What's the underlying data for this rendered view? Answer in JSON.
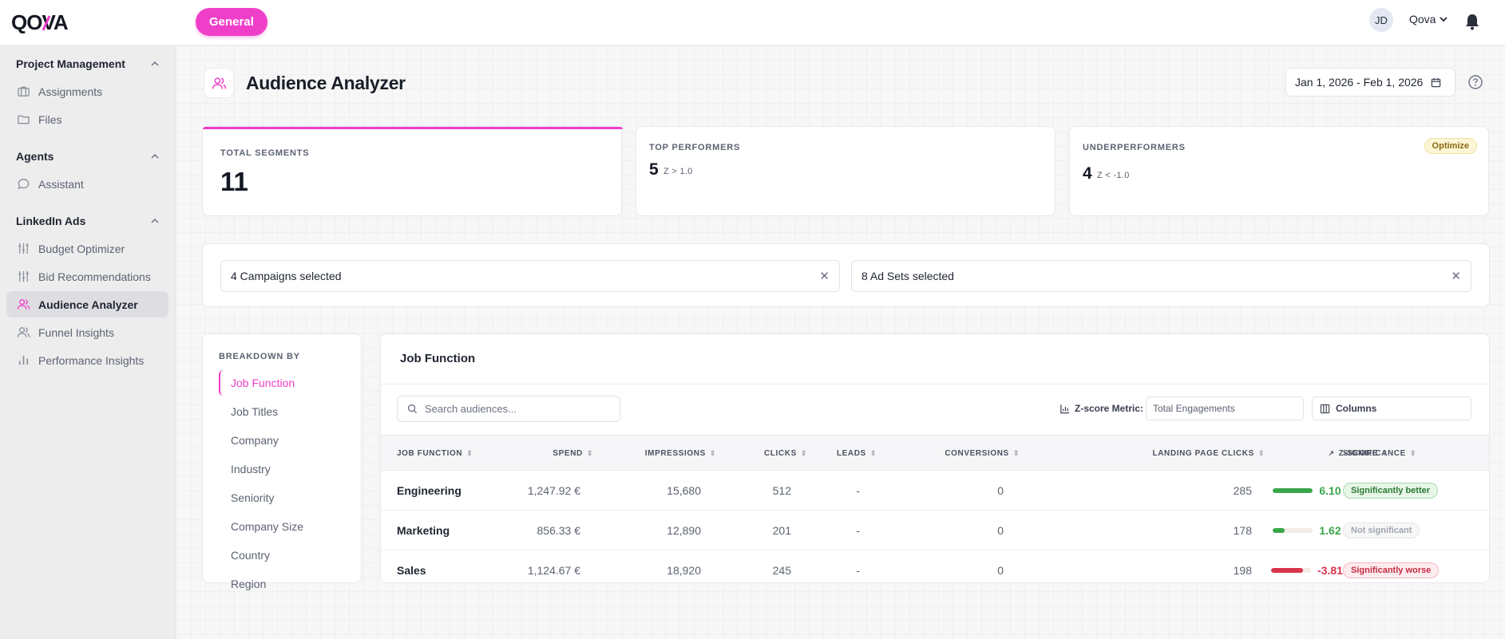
{
  "app": {
    "logo_text": "QOVA",
    "workspace_button": "General",
    "avatar_initials": "JD",
    "org_name": "Qova",
    "accent_color": "#ef3fc9"
  },
  "sidebar": {
    "sections": [
      {
        "title": "Project Management",
        "items": [
          {
            "label": "Assignments",
            "icon": "briefcase-icon"
          },
          {
            "label": "Files",
            "icon": "folder-icon"
          }
        ]
      },
      {
        "title": "Agents",
        "items": [
          {
            "label": "Assistant",
            "icon": "chat-bubble-icon"
          }
        ]
      },
      {
        "title": "LinkedIn Ads",
        "items": [
          {
            "label": "Budget Optimizer",
            "icon": "sliders-icon"
          },
          {
            "label": "Bid Recommendations",
            "icon": "sliders-icon"
          },
          {
            "label": "Audience Analyzer",
            "icon": "users-icon",
            "active": true
          },
          {
            "label": "Funnel Insights",
            "icon": "users-icon"
          },
          {
            "label": "Performance Insights",
            "icon": "bar-chart-icon"
          }
        ]
      }
    ]
  },
  "page": {
    "title": "Audience Analyzer",
    "date_range": "Jan 1, 2026 - Feb 1, 2026"
  },
  "stats": {
    "total_segments": {
      "label": "TOTAL SEGMENTS",
      "value": "11"
    },
    "top_performers": {
      "label": "TOP PERFORMERS",
      "value": "5",
      "sub": "Z > 1.0"
    },
    "underperformers": {
      "label": "UNDERPERFORMERS",
      "value": "4",
      "sub": "Z < -1.0",
      "badge": "Optimize"
    }
  },
  "filters": {
    "campaigns": "4 Campaigns selected",
    "ad_sets": "8 Ad Sets selected"
  },
  "breakdown": {
    "label": "BREAKDOWN BY",
    "options": [
      "Job Function",
      "Job Titles",
      "Company",
      "Industry",
      "Seniority",
      "Company Size",
      "Country",
      "Region"
    ],
    "selected": "Job Function"
  },
  "table": {
    "title": "Job Function",
    "search_placeholder": "Search audiences...",
    "zscore_metric_label": "Z-score Metric:",
    "zscore_metric_value": "Total Engagements",
    "columns_button": "Columns",
    "headers": [
      "JOB FUNCTION",
      "SPEND",
      "IMPRESSIONS",
      "CLICKS",
      "LEADS",
      "CONVERSIONS",
      "LANDING PAGE CLICKS",
      "Z-SCORE",
      "SIGNIFICANCE"
    ],
    "rows": [
      {
        "name": "Engineering",
        "spend": "1,247.92 €",
        "impressions": "15,680",
        "clicks": "512",
        "leads": "-",
        "conversions": "0",
        "lp_clicks": "285",
        "zscore": "6.10",
        "z_level": 1.0,
        "z_color": "#3aa64a",
        "significance": "Significantly better",
        "sig_bg": "#e8f6e8",
        "sig_border": "#a8d8aa",
        "sig_fg": "#2b7a34"
      },
      {
        "name": "Marketing",
        "spend": "856.33 €",
        "impressions": "12,890",
        "clicks": "201",
        "leads": "-",
        "conversions": "0",
        "lp_clicks": "178",
        "zscore": "1.62",
        "z_level": 0.3,
        "z_color": "#3aa64a",
        "significance": "Not significant",
        "sig_bg": "#f7f7f8",
        "sig_border": "#e6e6ea",
        "sig_fg": "#a0a5ae"
      },
      {
        "name": "Sales",
        "spend": "1,124.67 €",
        "impressions": "18,920",
        "clicks": "245",
        "leads": "-",
        "conversions": "0",
        "lp_clicks": "198",
        "zscore": "-3.81",
        "z_level": 0.8,
        "z_color": "#d8344a",
        "significance": "Significantly worse",
        "sig_bg": "#fdecef",
        "sig_border": "#f3b6c0",
        "sig_fg": "#c42a40"
      }
    ]
  }
}
